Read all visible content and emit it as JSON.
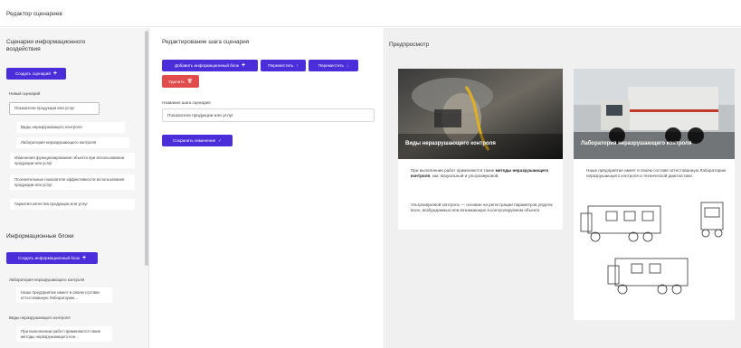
{
  "app": {
    "title": "Редактор сценариев"
  },
  "sidebar": {
    "scenarios_title": "Сценарии информационного воздействия",
    "create_scenario_label": "Создать сценарий",
    "new_scenario_label": "Новый сценарий",
    "scenario_items": [
      "Показатели продукции или услуг",
      "Виды неразрушающего контроля",
      "Лаборатория неразрушающего контроля",
      "Изменения функционирования объекта при использовании продукции или услуг",
      "Полезительные показатели эффективности использования продукции или услуг",
      "Гарантия качества продукции или услуг"
    ],
    "blocks_title": "Информационные блоки",
    "create_block_label": "Создать информационный блок",
    "block_items": [
      "Лаборатория неразрушающего контроля",
      "Наше предприятие имеет в своем составе аттестованную Лабораторию...",
      "Виды неразрушающего контроля",
      "При выполнении работ применяются такие методы неразрушающего кон..."
    ]
  },
  "editor": {
    "title": "Редактирование шага сценария",
    "add_block_label": "Добавить информационный блок",
    "move_up_label": "Переместить",
    "move_down_label": "Переместить",
    "delete_label": "Удалить",
    "step_name_label": "Название шага сценария",
    "step_name_value": "Показатели продукции или услуг",
    "save_label": "Сохранить изменения"
  },
  "preview": {
    "title": "Предпросмотр",
    "cards": [
      {
        "caption": "Виды неразрушающего контроля",
        "text_1_pre": "При выполнении работ применяются такие ",
        "text_1_bold": "методы неразрушающего контроля",
        "text_1_post": ", как: визуальный и ультразвуковой.",
        "text_2": "Ультразвуковой контроль — основан на регистрации параметров упругих волн, возбуждаемых или возникающих в контролируемом объекте."
      },
      {
        "caption": "Лаборатория неразрушающего контроля",
        "text_1": "Наше предприятие имеет в своем составе аттестованную Лабораторию неразрушающего контроля и технической диагностики."
      }
    ]
  },
  "colors": {
    "accent": "#4b2ed9",
    "danger": "#e04b4b",
    "preview_bg": "#f0f0f1",
    "sidebar_bg": "#f5f5f6"
  },
  "icons": {
    "plus": "plus-icon",
    "arrow_up": "arrow-up-icon",
    "arrow_down": "arrow-down-icon",
    "trash": "trash-icon",
    "check": "check-icon"
  }
}
